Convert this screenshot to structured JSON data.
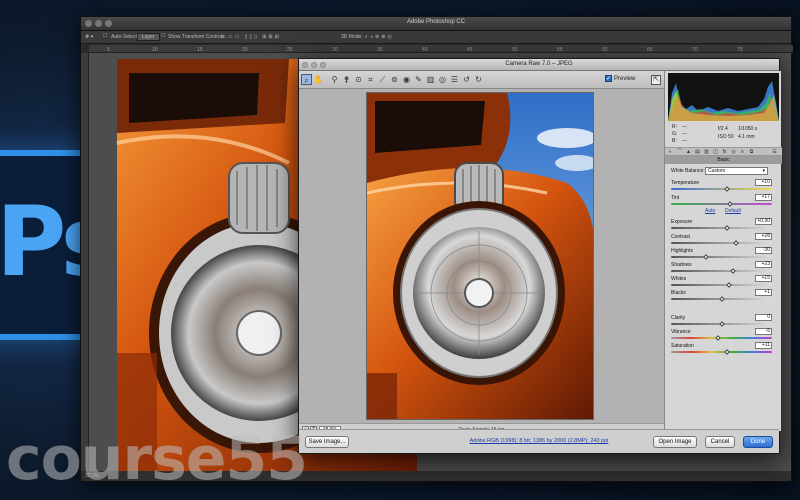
{
  "branding": {
    "logo_text": "Ps",
    "watermark": "course55"
  },
  "photoshop": {
    "title": "Adobe Photoshop CC",
    "options_bar": {
      "auto_select": "Auto-Select:",
      "layer": "Layer",
      "show_transform": "Show Transform Controls",
      "mode_3d": "3D Mode:"
    },
    "status_text": "33.3%"
  },
  "camera_raw": {
    "title": "Camera Raw 7.0 – JPEG",
    "preview_label": "Preview",
    "preview_checked": "✓",
    "zoom_level": "38.8%",
    "filename": "Davis Sample-15.jpg",
    "readout": {
      "r": "R:",
      "g": "G:",
      "b": "B:",
      "dashes": "---",
      "aperture": "f/2.4",
      "shutter": "1/1050 s",
      "iso": "ISO 50",
      "focal": "4.1 mm"
    },
    "section_title": "Basic",
    "white_balance": {
      "label": "White Balance:",
      "value": "Custom"
    },
    "auto_link": "Auto",
    "default_link": "Default",
    "adjustments": [
      {
        "label": "Temperature",
        "value": "+10",
        "pos": 0.55
      },
      {
        "label": "Tint",
        "value": "+17",
        "pos": 0.58
      },
      {
        "label": "Exposure",
        "value": "+0.30",
        "pos": 0.55
      },
      {
        "label": "Contrast",
        "value": "+28",
        "pos": 0.64
      },
      {
        "label": "Highlights",
        "value": "-30",
        "pos": 0.35
      },
      {
        "label": "Shadows",
        "value": "+23",
        "pos": 0.61
      },
      {
        "label": "Whites",
        "value": "+15",
        "pos": 0.57
      },
      {
        "label": "Blacks",
        "value": "+1",
        "pos": 0.5
      },
      {
        "label": "Clarity",
        "value": "0",
        "pos": 0.5
      },
      {
        "label": "Vibrance",
        "value": "-5",
        "pos": 0.47
      },
      {
        "label": "Saturation",
        "value": "+11",
        "pos": 0.55
      }
    ],
    "footer": {
      "save_button": "Save Image...",
      "workflow_link": "Adobe RGB (1998); 8 bit; 1386 by 2000 (2.8MP); 240 ppi",
      "open_button": "Open Image",
      "cancel_button": "Cancel",
      "done_button": "Done"
    }
  },
  "colors": {
    "accent": "#2f6fd0",
    "ps_brand": "#2f8fe6",
    "car_orange": "#d4550f"
  }
}
